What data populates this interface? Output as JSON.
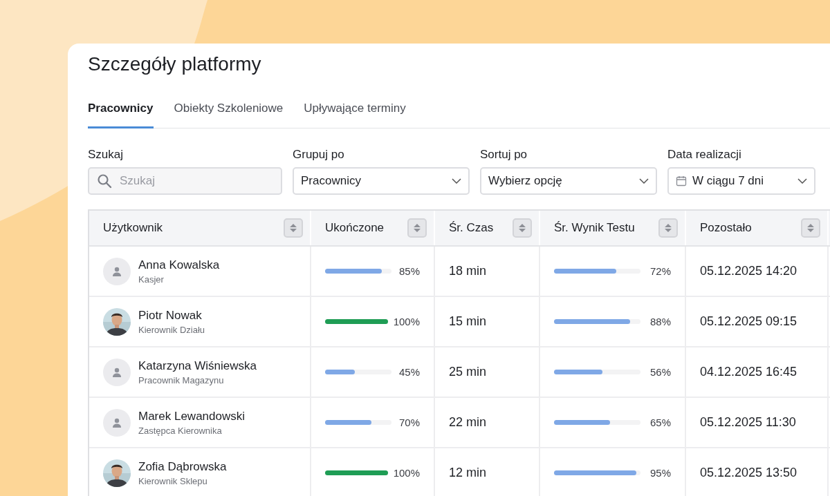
{
  "title": "Szczegóły platformy",
  "tabs": [
    {
      "label": "Pracownicy",
      "selected": true
    },
    {
      "label": "Obiekty Szkoleniowe",
      "selected": false
    },
    {
      "label": "Upływające terminy",
      "selected": false
    }
  ],
  "filters": [
    {
      "kind": "search",
      "label": "Szukaj",
      "placeholder": "Szukaj"
    },
    {
      "kind": "select",
      "label": "Grupuj po",
      "value": "Pracownicy"
    },
    {
      "kind": "select",
      "label": "Sortuj po",
      "value": "Wybierz opcję"
    },
    {
      "kind": "date",
      "label": "Data realizacji",
      "value": "W ciągu 7 dni"
    }
  ],
  "table": {
    "columns": [
      "Użytkownik",
      "Ukończone",
      "Śr. Czas",
      "Śr. Wynik Testu",
      "Pozostało"
    ],
    "rows": [
      {
        "name": "Anna Kowalska",
        "role": "Kasjer",
        "avatar": {
          "kind": "placeholder"
        },
        "completed": {
          "level": 0.85,
          "reading": "85%"
        },
        "time": "18 min",
        "score": {
          "level": 0.72,
          "reading": "72%"
        },
        "remaining": "05.12.2025 14:20"
      },
      {
        "name": "Piotr Nowak",
        "role": "Kierownik Działu",
        "completed": {
          "level": 1,
          "reading": "100%"
        },
        "time": "15 min",
        "score": {
          "level": 0.88,
          "reading": "88%"
        },
        "remaining": "05.12.2025 09:15"
      },
      {
        "name": "Katarzyna Wiśniewska",
        "role": "Pracownik Magazynu",
        "avatar": {
          "kind": "placeholder"
        },
        "completed": {
          "level": 0.45,
          "reading": "45%"
        },
        "time": "25 min",
        "score": {
          "level": 0.56,
          "reading": "56%"
        },
        "remaining": "04.12.2025 16:45"
      },
      {
        "name": "Marek Lewandowski",
        "role": "Zastępca Kierownika",
        "avatar": {
          "kind": "placeholder"
        },
        "completed": {
          "level": 0.7,
          "reading": "70%"
        },
        "time": "22 min",
        "score": {
          "level": 0.65,
          "reading": "65%"
        },
        "remaining": "05.12.2025 11:30"
      },
      {
        "name": "Zofia Dąbrowska",
        "role": "Kierownik Sklepu",
        "completed": {
          "level": 1,
          "reading": "100%"
        },
        "time": "12 min",
        "score": {
          "level": 0.95,
          "reading": "95%"
        },
        "remaining": "05.12.2025 13:50"
      }
    ]
  }
}
